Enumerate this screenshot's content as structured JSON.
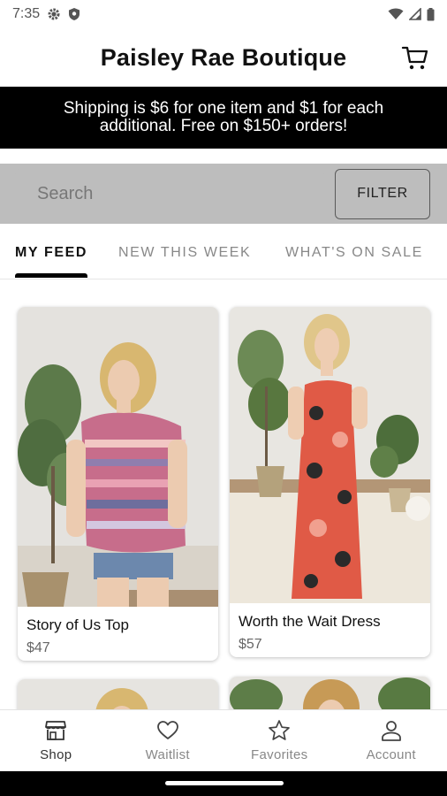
{
  "status_bar": {
    "time": "7:35"
  },
  "header": {
    "title": "Paisley Rae Boutique"
  },
  "banner": {
    "text": "Shipping is $6 for one item and $1 for each additional.  Free on $150+ orders!"
  },
  "search": {
    "placeholder": "Search",
    "filter_label": "FILTER"
  },
  "tabs": [
    {
      "label": "MY FEED",
      "active": true
    },
    {
      "label": "NEW THIS WEEK",
      "active": false
    },
    {
      "label": "WHAT'S ON SALE",
      "active": false
    }
  ],
  "products": [
    {
      "name": "Story of Us Top",
      "price": "$47"
    },
    {
      "name": "Worth the Wait Dress",
      "price": "$57"
    }
  ],
  "bottom_nav": [
    {
      "label": "Shop",
      "icon": "storefront-icon",
      "active": true
    },
    {
      "label": "Waitlist",
      "icon": "heart-icon",
      "active": false
    },
    {
      "label": "Favorites",
      "icon": "star-icon",
      "active": false
    },
    {
      "label": "Account",
      "icon": "person-icon",
      "active": false
    }
  ]
}
